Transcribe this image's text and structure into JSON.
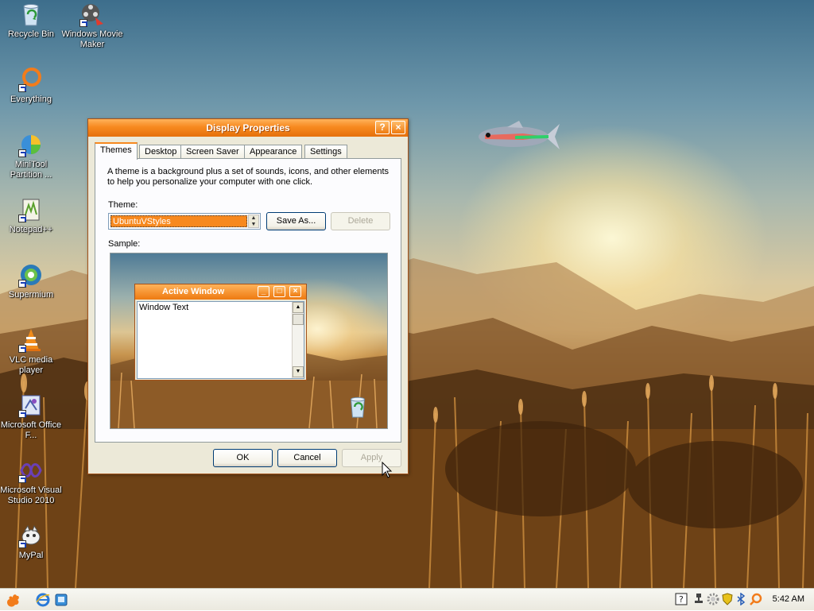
{
  "desktop": {
    "icons": [
      {
        "label": "Recycle Bin",
        "icon": "recycle-bin-icon"
      },
      {
        "label": "Windows Movie Maker",
        "icon": "movie-maker-icon"
      },
      {
        "label": "Everything",
        "icon": "everything-icon"
      },
      {
        "label": "MiniTool Partition ...",
        "icon": "minitool-icon"
      },
      {
        "label": "Notepad++",
        "icon": "notepadpp-icon"
      },
      {
        "label": "Supermium",
        "icon": "supermium-icon"
      },
      {
        "label": "VLC media player",
        "icon": "vlc-icon"
      },
      {
        "label": "Microsoft Office F...",
        "icon": "office-icon"
      },
      {
        "label": "Microsoft Visual Studio 2010",
        "icon": "visual-studio-icon"
      },
      {
        "label": "MyPal",
        "icon": "mypal-icon"
      }
    ]
  },
  "dialog": {
    "title": "Display Properties",
    "help_label": "?",
    "close_label": "×",
    "tabs": [
      {
        "label": "Themes",
        "active": true
      },
      {
        "label": "Desktop",
        "active": false
      },
      {
        "label": "Screen Saver",
        "active": false
      },
      {
        "label": "Appearance",
        "active": false
      },
      {
        "label": "Settings",
        "active": false
      }
    ],
    "description": "A theme is a background plus a set of sounds, icons, and other elements to help you personalize your computer with one click.",
    "theme_label": "Theme:",
    "theme_value": "UbuntuVStyles",
    "save_as_label": "Save As...",
    "delete_label": "Delete",
    "sample_label": "Sample:",
    "sample": {
      "window_title": "Active Window",
      "window_text": "Window Text"
    },
    "ok_label": "OK",
    "cancel_label": "Cancel",
    "apply_label": "Apply"
  },
  "taskbar": {
    "clock": "5:42 AM",
    "quicklaunch": [
      "start-gnome-icon",
      "internet-explorer-icon",
      "show-desktop-icon"
    ],
    "tray_icons": [
      "help-icon",
      "network-icon",
      "shield-icon",
      "settings-icon",
      "bluetooth-icon",
      "search-icon"
    ]
  },
  "colors": {
    "accent": "#f7891f",
    "dialog_bg": "#ece9d8",
    "panel_bg": "#fcfcfe"
  }
}
